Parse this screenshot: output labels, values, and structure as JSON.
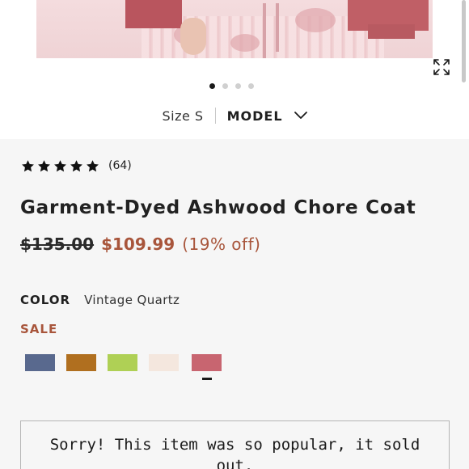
{
  "product_image": {
    "alt": "",
    "carousel": {
      "count": 4,
      "active_index": 0
    },
    "expand_icon": "expand-arrows-icon"
  },
  "size_selector": {
    "size_label": "Size S",
    "model_label": "MODEL",
    "chevron_icon": "chevron-down-icon"
  },
  "rating": {
    "stars": 5,
    "review_count": "(64)"
  },
  "product": {
    "title": "Garment-Dyed Ashwood Chore Coat",
    "original_price": "$135.00",
    "sale_price": "$109.99",
    "discount": "(19% off)"
  },
  "color": {
    "label": "COLOR",
    "value": "Vintage Quartz",
    "sale_label": "SALE",
    "swatches": [
      {
        "color": "#59698e"
      },
      {
        "color": "#b06f1f"
      },
      {
        "color": "#afd055"
      },
      {
        "color": "#f4e7de"
      },
      {
        "color": "#c86570",
        "selected": true
      }
    ]
  },
  "sold_out": {
    "message": "Sorry! This item was so popular, it sold out."
  },
  "colors": {
    "accent": "#a8553b",
    "text": "#1c1c1c",
    "background": "#f6f6f6"
  }
}
